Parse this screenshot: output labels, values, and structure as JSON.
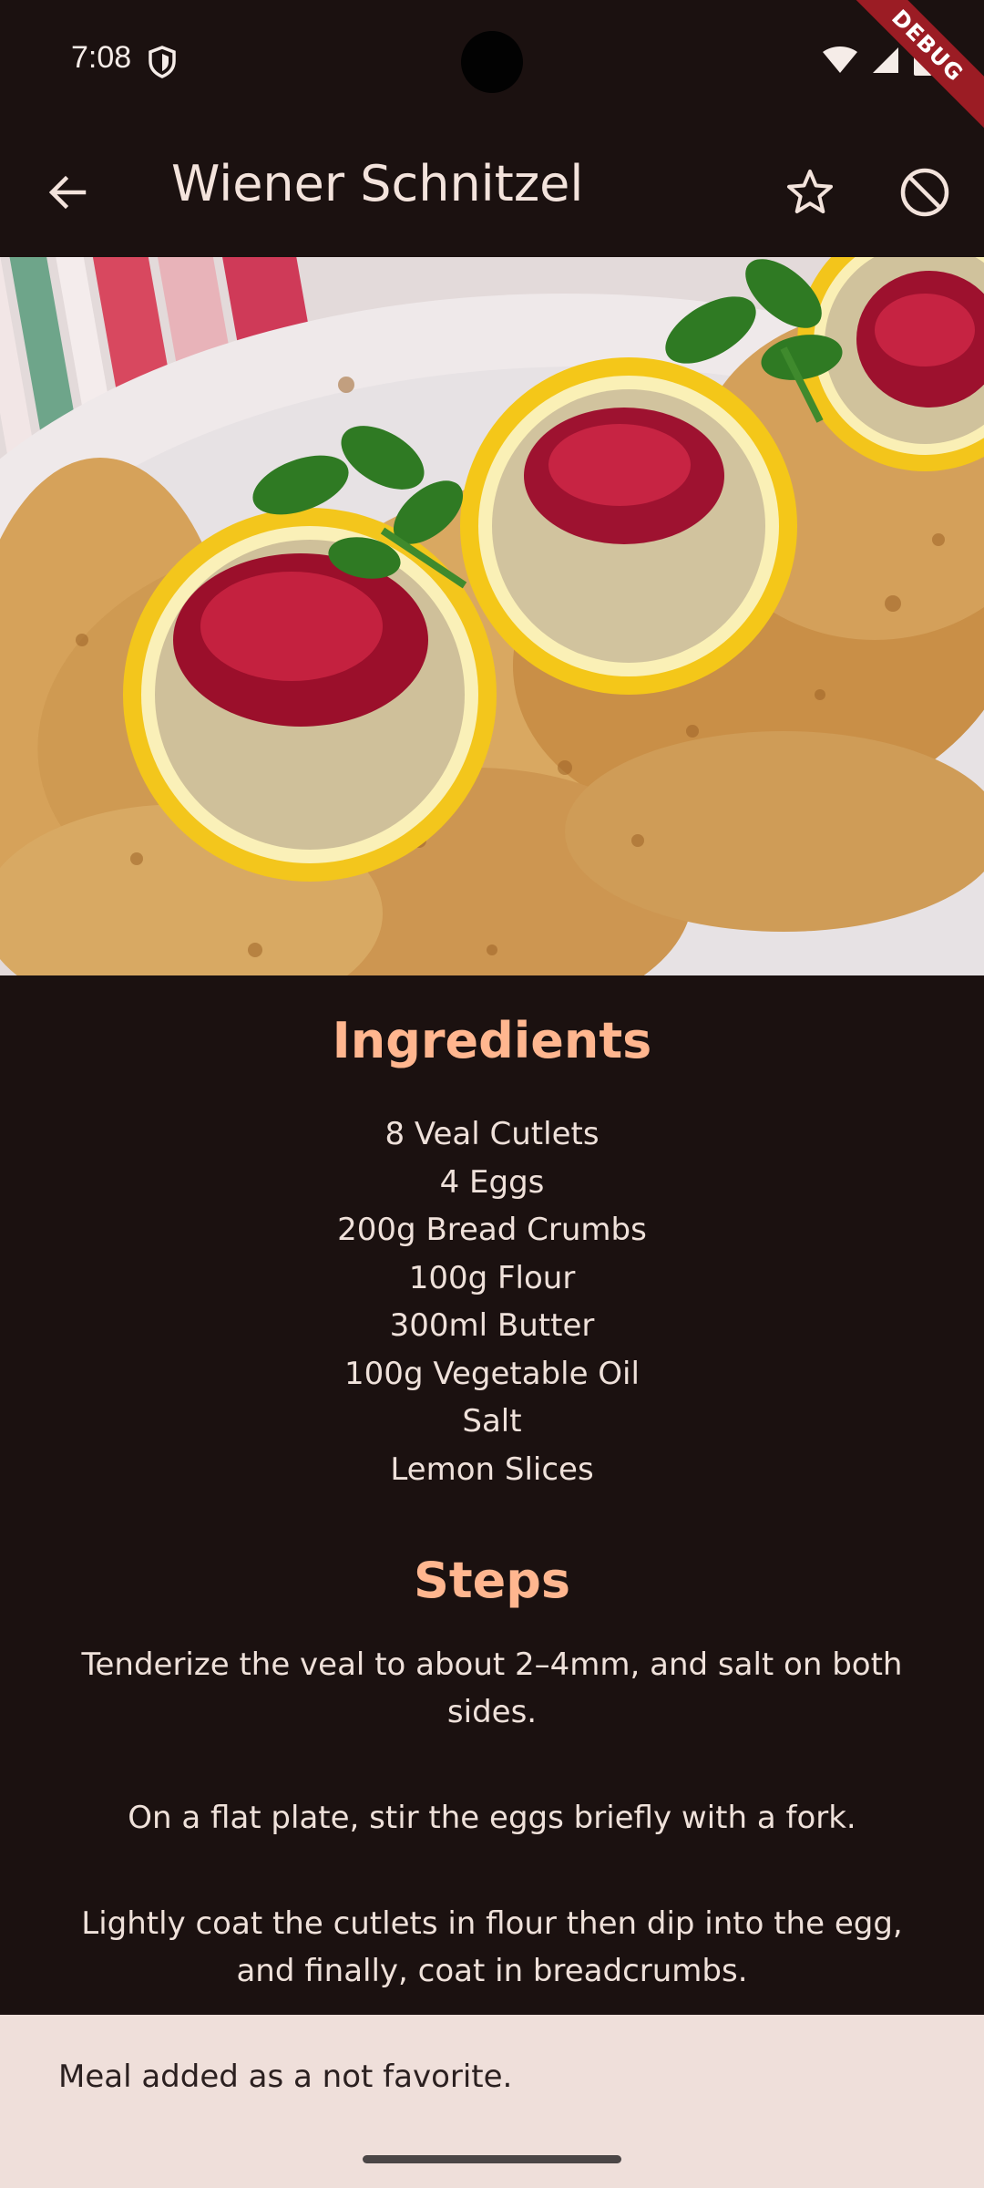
{
  "status_bar": {
    "time": "7:08",
    "debug_label": "DEBUG"
  },
  "app_bar": {
    "title": "Wiener Schnitzel",
    "icons": [
      "back-arrow-icon",
      "star-outline-icon",
      "block-icon"
    ]
  },
  "image": {
    "description_icon": "meal-photo"
  },
  "ingredients": {
    "heading": "Ingredients",
    "items": [
      "8 Veal Cutlets",
      "4 Eggs",
      "200g Bread Crumbs",
      "100g Flour",
      "300ml Butter",
      "100g Vegetable Oil",
      "Salt",
      "Lemon Slices"
    ]
  },
  "steps": {
    "heading": "Steps",
    "items": [
      "Tenderize the veal to about 2–4mm, and salt on both sides.",
      "On a flat plate, stir the eggs briefly with a fork.",
      "Lightly coat the cutlets in flour then dip into the egg, and finally, coat in breadcrumbs."
    ]
  },
  "snackbar": {
    "message": "Meal added as a not favorite."
  },
  "colors": {
    "background": "#1b1110",
    "accent": "#ffb68f",
    "snackbar": "#efdfda",
    "debug": "#9b1c24"
  }
}
